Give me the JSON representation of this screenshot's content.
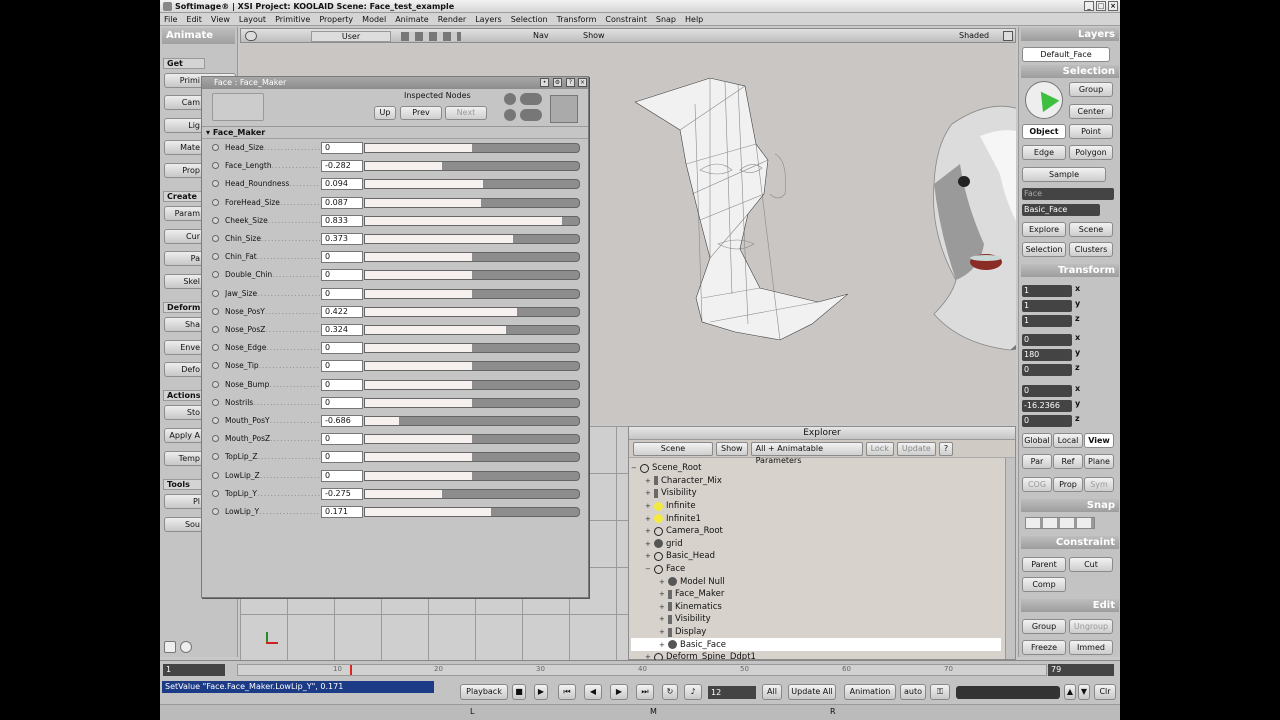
{
  "window": {
    "title": "Softimage® | XSI Project: KOOLAID    Scene: Face_test_example"
  },
  "menu": [
    "File",
    "Edit",
    "View",
    "Layout",
    "Primitive",
    "Property",
    "Model",
    "Animate",
    "Render",
    "Layers",
    "Selection",
    "Transform",
    "Constraint",
    "Snap",
    "Help"
  ],
  "left_panel": {
    "title": "Animate",
    "sections": {
      "get": "Get",
      "create": "Create",
      "deform": "Deform",
      "actions": "Actions",
      "tools": "Tools"
    },
    "buttons": [
      "Primi",
      "Cam",
      "Lig",
      "Mate",
      "Prop",
      "Param",
      "Cur",
      "Pa",
      "Skel",
      "Sha",
      "Enve",
      "Defo",
      "Sto",
      "Apply A",
      "Temp",
      "Pl",
      "Sou"
    ]
  },
  "viewport": {
    "camera": "User",
    "nav": "Nav",
    "show": "Show",
    "mode": "Shaded"
  },
  "property_editor": {
    "title": "Face : Face_Maker",
    "inspected_nodes": "Inspected Nodes",
    "up": "Up",
    "prev": "Prev",
    "next": "Next",
    "section": "Face_Maker",
    "params": [
      {
        "name": "Head_Size",
        "value": "0",
        "fill": 0.5
      },
      {
        "name": "Face_Length",
        "value": "-0.282",
        "fill": 0.36
      },
      {
        "name": "Head_Roundness",
        "value": "0.094",
        "fill": 0.55
      },
      {
        "name": "ForeHead_Size",
        "value": "0.087",
        "fill": 0.54
      },
      {
        "name": "Cheek_Size",
        "value": "0.833",
        "fill": 0.92
      },
      {
        "name": "Chin_Size",
        "value": "0.373",
        "fill": 0.69
      },
      {
        "name": "Chin_Fat",
        "value": "0",
        "fill": 0.5
      },
      {
        "name": "Double_Chin",
        "value": "0",
        "fill": 0.5
      },
      {
        "name": "Jaw_Size",
        "value": "0",
        "fill": 0.5
      },
      {
        "name": "Nose_PosY",
        "value": "0.422",
        "fill": 0.71
      },
      {
        "name": "Nose_PosZ",
        "value": "0.324",
        "fill": 0.66
      },
      {
        "name": "Nose_Edge",
        "value": "0",
        "fill": 0.5
      },
      {
        "name": "Nose_Tip",
        "value": "0",
        "fill": 0.5
      },
      {
        "name": "Nose_Bump",
        "value": "0",
        "fill": 0.5
      },
      {
        "name": "Nostrils",
        "value": "0",
        "fill": 0.5
      },
      {
        "name": "Mouth_PosY",
        "value": "-0.686",
        "fill": 0.16
      },
      {
        "name": "Mouth_PosZ",
        "value": "0",
        "fill": 0.5
      },
      {
        "name": "TopLip_Z",
        "value": "0",
        "fill": 0.5
      },
      {
        "name": "LowLip_Z",
        "value": "0",
        "fill": 0.5
      },
      {
        "name": "TopLip_Y",
        "value": "-0.275",
        "fill": 0.36
      },
      {
        "name": "LowLip_Y",
        "value": "0.171",
        "fill": 0.59
      }
    ]
  },
  "explorer": {
    "title": "Explorer",
    "scene": "Scene",
    "show": "Show",
    "filter": "All + Animatable Parameters",
    "lock": "Lock",
    "update": "Update",
    "tree": [
      {
        "label": "Scene_Root",
        "indent": 0,
        "icon": "null"
      },
      {
        "label": "Character_Mix",
        "indent": 1,
        "icon": "bar"
      },
      {
        "label": "Visibility",
        "indent": 1,
        "icon": "bar"
      },
      {
        "label": "Infinite",
        "indent": 1,
        "icon": "light"
      },
      {
        "label": "Infinite1",
        "indent": 1,
        "icon": "light"
      },
      {
        "label": "Camera_Root",
        "indent": 1,
        "icon": "null"
      },
      {
        "label": "grid",
        "indent": 1,
        "icon": "grid"
      },
      {
        "label": "Basic_Head",
        "indent": 1,
        "icon": "null"
      },
      {
        "label": "Face",
        "indent": 1,
        "icon": "null"
      },
      {
        "label": "Model Null",
        "indent": 2,
        "icon": "grid"
      },
      {
        "label": "Face_Maker",
        "indent": 2,
        "icon": "bar"
      },
      {
        "label": "Kinematics",
        "indent": 2,
        "icon": "bar"
      },
      {
        "label": "Visibility",
        "indent": 2,
        "icon": "bar"
      },
      {
        "label": "Display",
        "indent": 2,
        "icon": "bar"
      },
      {
        "label": "Basic_Face",
        "indent": 2,
        "icon": "grid"
      },
      {
        "label": "Deform_Spine_Ddpt1",
        "indent": 1,
        "icon": "null"
      }
    ]
  },
  "right_panel": {
    "layers": "Layers",
    "layer_value": "Default_Face",
    "selection": "Selection",
    "group": "Group",
    "center": "Center",
    "object": "Object",
    "point": "Point",
    "edge": "Edge",
    "polygon": "Polygon",
    "sample": "Sample",
    "face_field": "Face",
    "basic_face": "Basic_Face",
    "explore": "Explore",
    "scene": "Scene",
    "selection_btn": "Selection",
    "clusters": "Clusters",
    "transform": "Transform",
    "scale": [
      "1",
      "1",
      "1"
    ],
    "rotate": [
      "0",
      "180",
      "0"
    ],
    "translate": [
      "0",
      "-16.2366",
      "0"
    ],
    "axes": [
      "x",
      "y",
      "z"
    ],
    "global": "Global",
    "local": "Local",
    "view": "View",
    "par": "Par",
    "ref": "Ref",
    "plane": "Plane",
    "cog": "COG",
    "prop": "Prop",
    "sym": "Sym",
    "snap": "Snap",
    "constraint": "Constraint",
    "parent": "Parent",
    "cut": "Cut",
    "comp": "Comp",
    "edit": "Edit",
    "group_btn": "Group",
    "ungroup": "Ungroup",
    "freeze": "Freeze",
    "immed": "Immed"
  },
  "timeline": {
    "start": "1",
    "end": "79",
    "ticks": [
      "10",
      "20",
      "30",
      "40",
      "50",
      "60",
      "70"
    ]
  },
  "bottom": {
    "command": "SetValue \"Face.Face_Maker.LowLip_Y\", 0.171",
    "playback": "Playback",
    "frame": "12",
    "all": "All",
    "update_all": "Update All",
    "animation": "Animation",
    "auto": "auto",
    "clr": "Clr"
  },
  "status": [
    "L",
    "M",
    "R"
  ],
  "colors": {
    "accent": "#1c3b86",
    "light": "#f2ea40",
    "mouth": "#8b2b25"
  }
}
